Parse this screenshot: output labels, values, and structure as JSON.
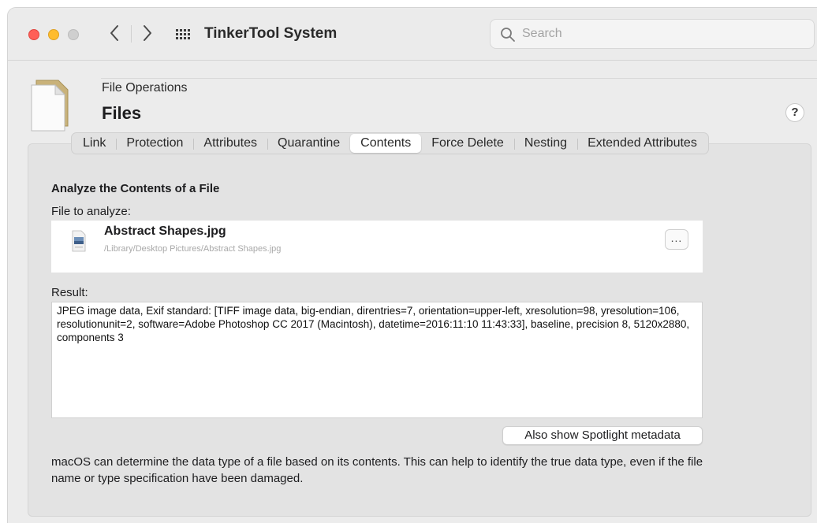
{
  "window": {
    "title": "TinkerTool System",
    "search": {
      "placeholder": "Search"
    }
  },
  "header": {
    "subtitle": "File Operations",
    "title": "Files",
    "help_label": "?"
  },
  "tabs": [
    {
      "label": "Link",
      "active": false
    },
    {
      "label": "Protection",
      "active": false
    },
    {
      "label": "Attributes",
      "active": false
    },
    {
      "label": "Quarantine",
      "active": false
    },
    {
      "label": "Contents",
      "active": true
    },
    {
      "label": "Force Delete",
      "active": false
    },
    {
      "label": "Nesting",
      "active": false
    },
    {
      "label": "Extended Attributes",
      "active": false
    }
  ],
  "contents": {
    "heading": "Analyze the Contents of a File",
    "file_label": "File to analyze:",
    "file": {
      "name": "Abstract Shapes.jpg",
      "path": "/Library/Desktop Pictures/Abstract Shapes.jpg",
      "more_label": "..."
    },
    "result_label": "Result:",
    "result_text": "JPEG image data, Exif standard: [TIFF image data, big-endian, direntries=7, orientation=upper-left, xresolution=98, yresolution=106, resolutionunit=2, software=Adobe Photoshop CC 2017 (Macintosh), datetime=2016:11:10 11:43:33], baseline, precision 8, 5120x2880, components 3",
    "spotlight_button": "Also show Spotlight metadata",
    "description": "macOS can determine the data type of a file based on its contents. This can help to identify the true data type, even if the file name or type specification have been damaged."
  }
}
